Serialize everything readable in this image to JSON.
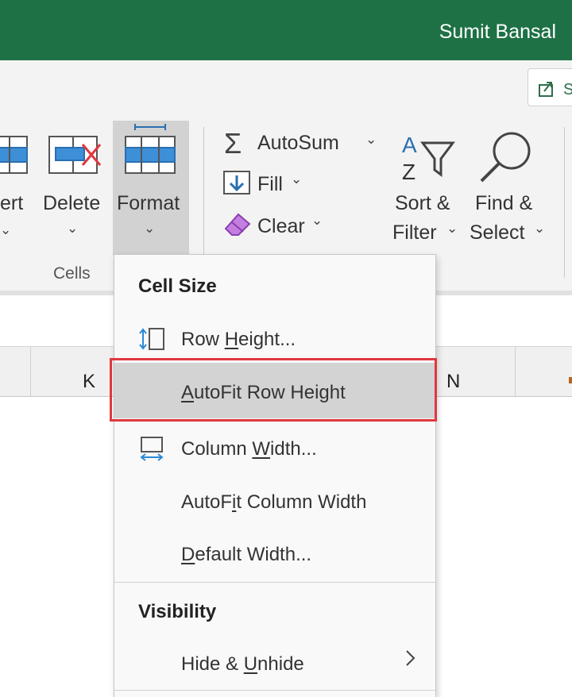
{
  "titlebar": {
    "user_name": "Sumit Bansal",
    "color": "#1e7145"
  },
  "ribbon": {
    "insert_label_partial": "ert",
    "delete_label": "Delete",
    "format_label": "Format",
    "cells_group_label": "Cells",
    "autosum_label": "AutoSum",
    "fill_label": "Fill",
    "clear_label": "Clear",
    "sort_filter": {
      "line1": "Sort &",
      "line2": "Filter"
    },
    "find_select": {
      "line1": "Find &",
      "line2": "Select"
    },
    "icons": [
      "insert-cells-icon",
      "delete-cells-icon",
      "format-cells-icon",
      "sigma-icon",
      "fill-down-icon",
      "eraser-icon",
      "sort-filter-icon",
      "magnifier-icon",
      "share-icon"
    ]
  },
  "columns": {
    "k": "K",
    "n": "N"
  },
  "format_menu": {
    "cell_size_heading": "Cell Size",
    "row_height": {
      "pre": "Row ",
      "key": "H",
      "post": "eight..."
    },
    "autofit_row_height": {
      "pre": "",
      "key": "A",
      "post": "utoFit Row Height"
    },
    "column_width": {
      "pre": "Column ",
      "key": "W",
      "post": "idth..."
    },
    "autofit_column_width": {
      "pre": "AutoF",
      "key": "i",
      "post": "t Column Width"
    },
    "default_width": {
      "pre": "",
      "key": "D",
      "post": "efault Width..."
    },
    "visibility_heading": "Visibility",
    "hide_unhide": {
      "pre": "Hide & ",
      "key": "U",
      "post": "nhide"
    },
    "highlight_color": "#e0383e"
  }
}
